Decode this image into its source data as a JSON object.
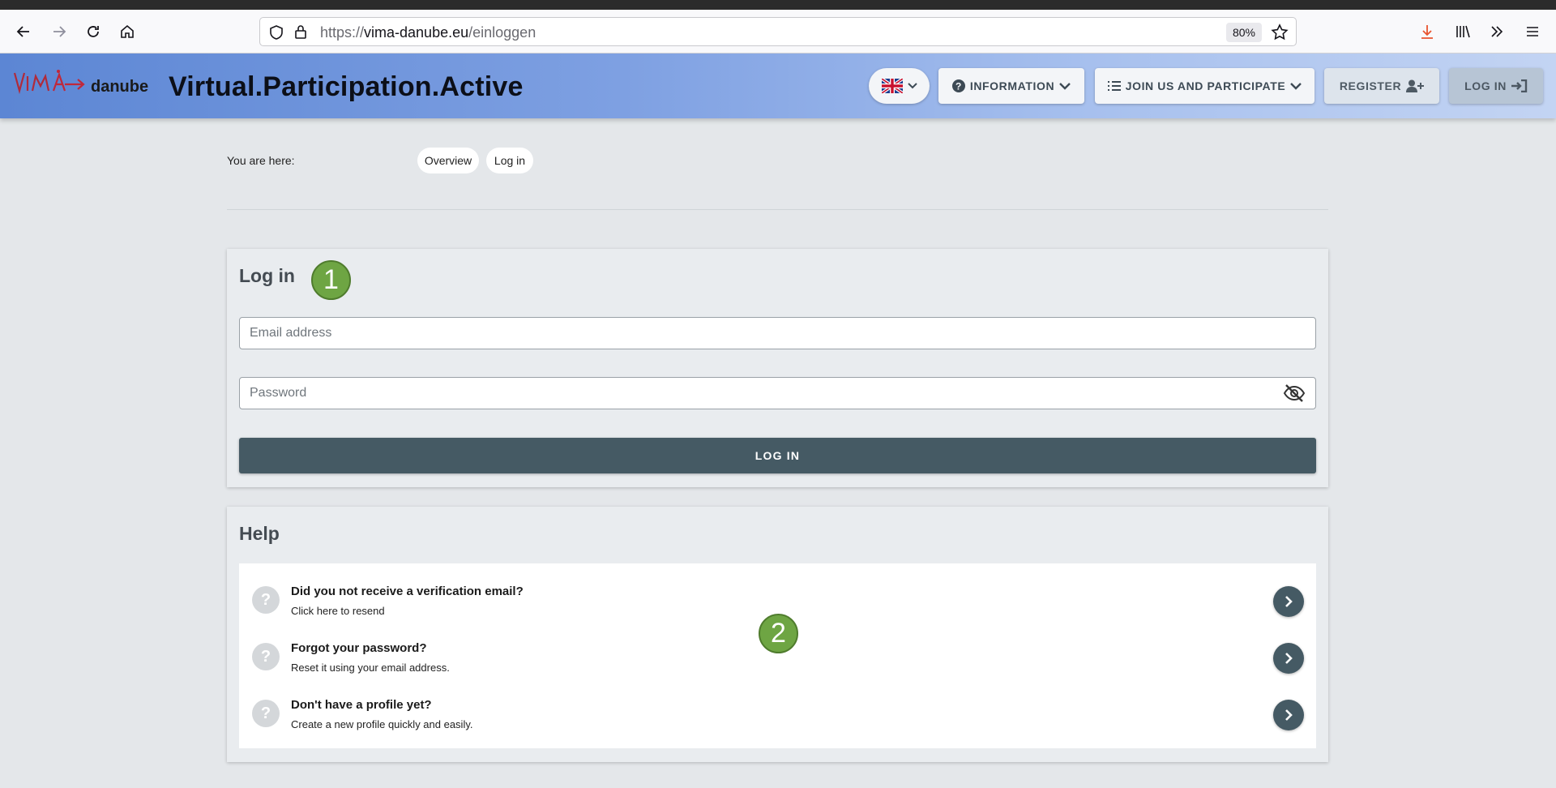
{
  "browser": {
    "url_prefix": "https://",
    "url_domain": "vima-danube.eu",
    "url_path": "/einloggen",
    "zoom": "80%"
  },
  "header": {
    "logo_text": "danube",
    "title": "Virtual.Participation.Active",
    "language": "en-GB",
    "info_label": "INFORMATION",
    "join_label": "JOIN US AND PARTICIPATE",
    "register_label": "REGISTER",
    "login_label": "LOG IN"
  },
  "breadcrumb": {
    "label": "You are here:",
    "items": [
      "Overview",
      "Log in"
    ]
  },
  "login": {
    "title": "Log in",
    "marker": "1",
    "email_placeholder": "Email address",
    "password_placeholder": "Password",
    "submit_label": "LOG IN"
  },
  "help": {
    "title": "Help",
    "marker": "2",
    "items": [
      {
        "title": "Did you not receive a verification email?",
        "subtitle": "Click here to resend"
      },
      {
        "title": "Forgot your password?",
        "subtitle": "Reset it using your email address."
      },
      {
        "title": "Don't have a profile yet?",
        "subtitle": "Create a new profile quickly and easily."
      }
    ]
  },
  "colors": {
    "header_gradient_start": "#5c86d4",
    "primary_button": "#455a64",
    "badge_green": "#6ea543",
    "page_bg": "#e4e7ea"
  }
}
